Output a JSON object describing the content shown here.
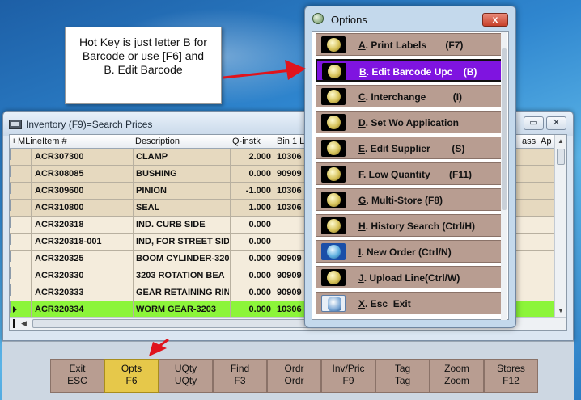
{
  "inventory_window": {
    "title": "Inventory (F9)=Search Prices",
    "buttons": {
      "restore": "▭",
      "close": "✕"
    }
  },
  "grid": {
    "headers": {
      "indicator": "+",
      "mline": "MLine",
      "item": "Item #",
      "description": "Description",
      "qinstk": "Q-instk",
      "bin": "Bin 1 L",
      "class": "ass",
      "ap": "Ap"
    },
    "rows": [
      {
        "item": "ACR307300",
        "description": "CLAMP",
        "qinstk": "2.000",
        "bin": "10306"
      },
      {
        "item": "ACR308085",
        "description": "BUSHING",
        "qinstk": "0.000",
        "bin": "90909"
      },
      {
        "item": "ACR309600",
        "description": "PINION",
        "qinstk": "-1.000",
        "bin": "10306"
      },
      {
        "item": "ACR310800",
        "description": "SEAL",
        "qinstk": "1.000",
        "bin": "10306"
      },
      {
        "item": "ACR320318",
        "description": "IND. CURB SIDE",
        "qinstk": "0.000",
        "bin": ""
      },
      {
        "item": "ACR320318-001",
        "description": "IND, FOR STREET SID",
        "qinstk": "0.000",
        "bin": ""
      },
      {
        "item": "ACR320325",
        "description": "BOOM CYLINDER-320",
        "qinstk": "0.000",
        "bin": "90909"
      },
      {
        "item": "ACR320330",
        "description": "3203 ROTATION BEA",
        "qinstk": "0.000",
        "bin": "90909"
      },
      {
        "item": "ACR320333",
        "description": "GEAR RETAINING RIN",
        "qinstk": "0.000",
        "bin": "90909"
      },
      {
        "item": "ACR320334",
        "description": "WORM GEAR-3203",
        "qinstk": "0.000",
        "bin": "10306"
      }
    ]
  },
  "toolbar": {
    "buttons": [
      {
        "line1": "Exit",
        "line2": "ESC"
      },
      {
        "line1": "Opts",
        "line2": "F6"
      },
      {
        "line1": "UQty",
        "line2": "UQty"
      },
      {
        "line1": "Find",
        "line2": "F3"
      },
      {
        "line1": "Ordr",
        "line2": "Ordr"
      },
      {
        "line1": "Inv/Pric",
        "line2": "F9"
      },
      {
        "line1": "Tag",
        "line2": "Tag"
      },
      {
        "line1": "Zoom",
        "line2": "Zoom"
      },
      {
        "line1": "Stores",
        "line2": "F12"
      }
    ]
  },
  "callout": {
    "line1": "Hot Key is just letter B for",
    "line2": "Barcode or use [F6] and",
    "line3": "B. Edit Barcode"
  },
  "options_dialog": {
    "title": "Options",
    "close": "x",
    "items": [
      {
        "key": "A",
        "rest": ". Print Labels       (F7)"
      },
      {
        "key": "B",
        "rest": ". Edit Barcode Upc    (B)"
      },
      {
        "key": "C",
        "rest": ". Interchange          (I)"
      },
      {
        "key": "D",
        "rest": ". Set Wo Application"
      },
      {
        "key": "E",
        "rest": ". Edit Supplier        (S)"
      },
      {
        "key": "F",
        "rest": ". Low Quantity       (F11)"
      },
      {
        "key": "G",
        "rest": ". Multi-Store (F8)"
      },
      {
        "key": "H",
        "rest": ". History Search (Ctrl/H)"
      },
      {
        "key": "I",
        "rest": ". New Order (Ctrl/N)"
      },
      {
        "key": "J",
        "rest": ". Upload Line(Ctrl/W)"
      },
      {
        "key": "X",
        "rest": ". Esc  Exit"
      }
    ]
  },
  "colors": {
    "row_tan": "#e6d9bf",
    "row_light": "#f4ecdc",
    "row_selected": "#8cf53a",
    "button_brown": "#b89d91",
    "button_active": "#e6c84a",
    "option_selected": "#7f14e0",
    "arrow_red": "#e0141c"
  }
}
